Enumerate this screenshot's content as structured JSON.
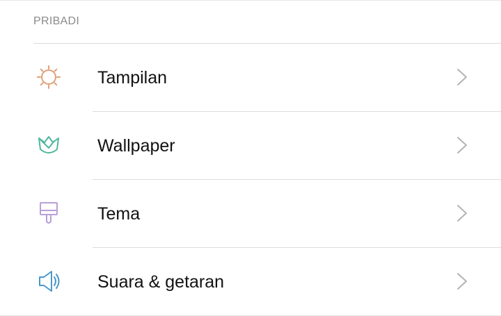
{
  "section": {
    "header": "PRIBADI"
  },
  "items": [
    {
      "label": "Tampilan",
      "icon": "sun-icon",
      "icon_color": "#e0a07a"
    },
    {
      "label": "Wallpaper",
      "icon": "tulip-icon",
      "icon_color": "#4fb79e"
    },
    {
      "label": "Tema",
      "icon": "paint-brush-icon",
      "icon_color": "#b9a0d8"
    },
    {
      "label": "Suara & getaran",
      "icon": "speaker-icon",
      "icon_color": "#4a97c9"
    }
  ],
  "colors": {
    "chevron": "#b3b3b3",
    "divider": "#dcdcdc",
    "text": "#121212",
    "header_text": "#8a8a8a"
  }
}
